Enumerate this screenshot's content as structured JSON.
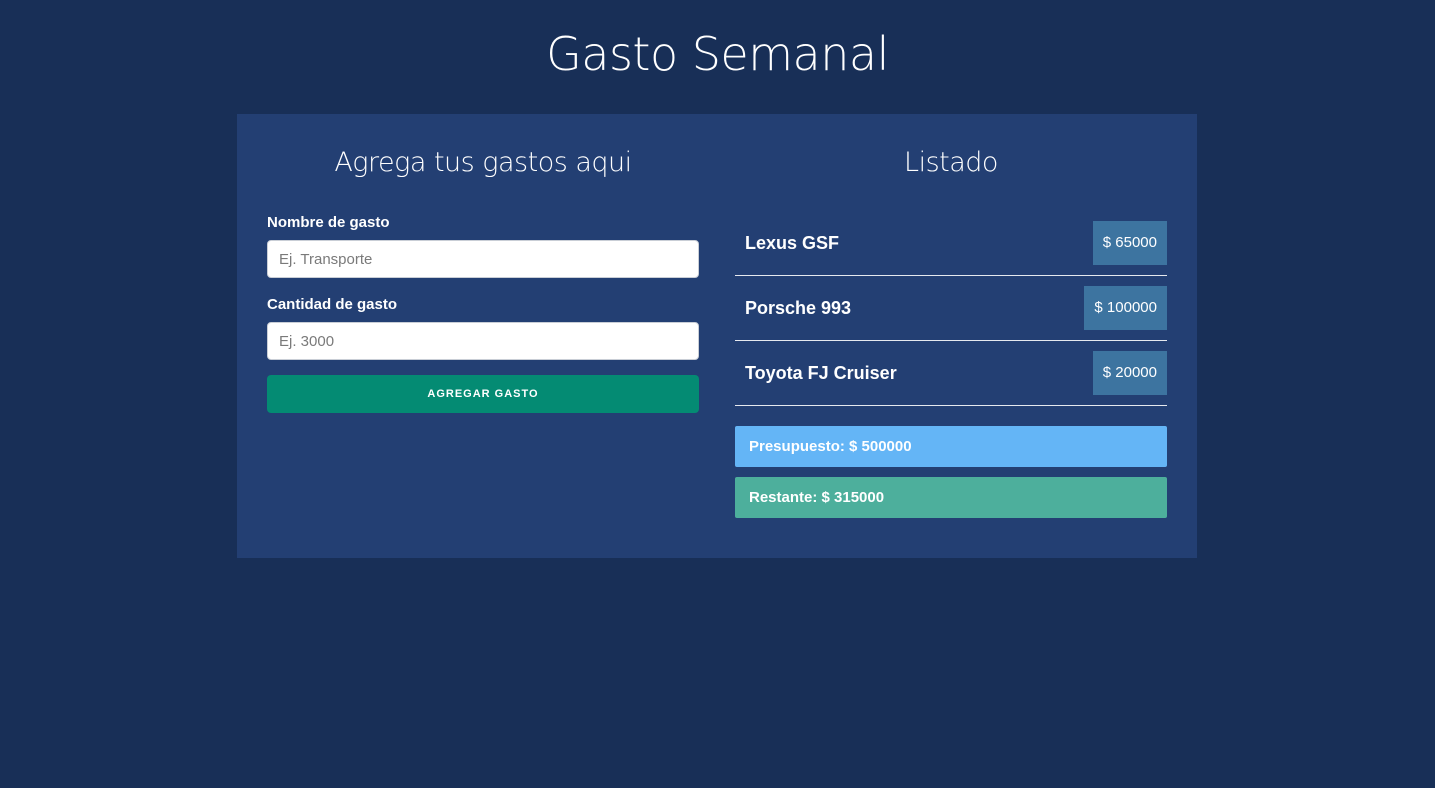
{
  "header": {
    "title": "Gasto Semanal"
  },
  "form": {
    "title": "Agrega tus gastos aqui",
    "name_label": "Nombre de gasto",
    "name_placeholder": "Ej. Transporte",
    "name_value": "",
    "amount_label": "Cantidad de gasto",
    "amount_placeholder": "Ej. 3000",
    "amount_value": "",
    "submit_label": "AGREGAR GASTO"
  },
  "listing": {
    "title": "Listado",
    "items": [
      {
        "name": "Lexus GSF",
        "amount": "$ 65000"
      },
      {
        "name": "Porsche 993",
        "amount": "$ 100000"
      },
      {
        "name": "Toyota FJ Cruiser",
        "amount": "$ 20000"
      }
    ]
  },
  "summary": {
    "budget": "Presupuesto: $ 500000",
    "remaining": "Restante: $ 315000"
  },
  "colors": {
    "background": "#182f57",
    "card": "#233f73",
    "submit": "#048b73",
    "amount_badge": "#3d74a0",
    "budget": "#64b5f6",
    "remaining": "#4daf9c"
  }
}
